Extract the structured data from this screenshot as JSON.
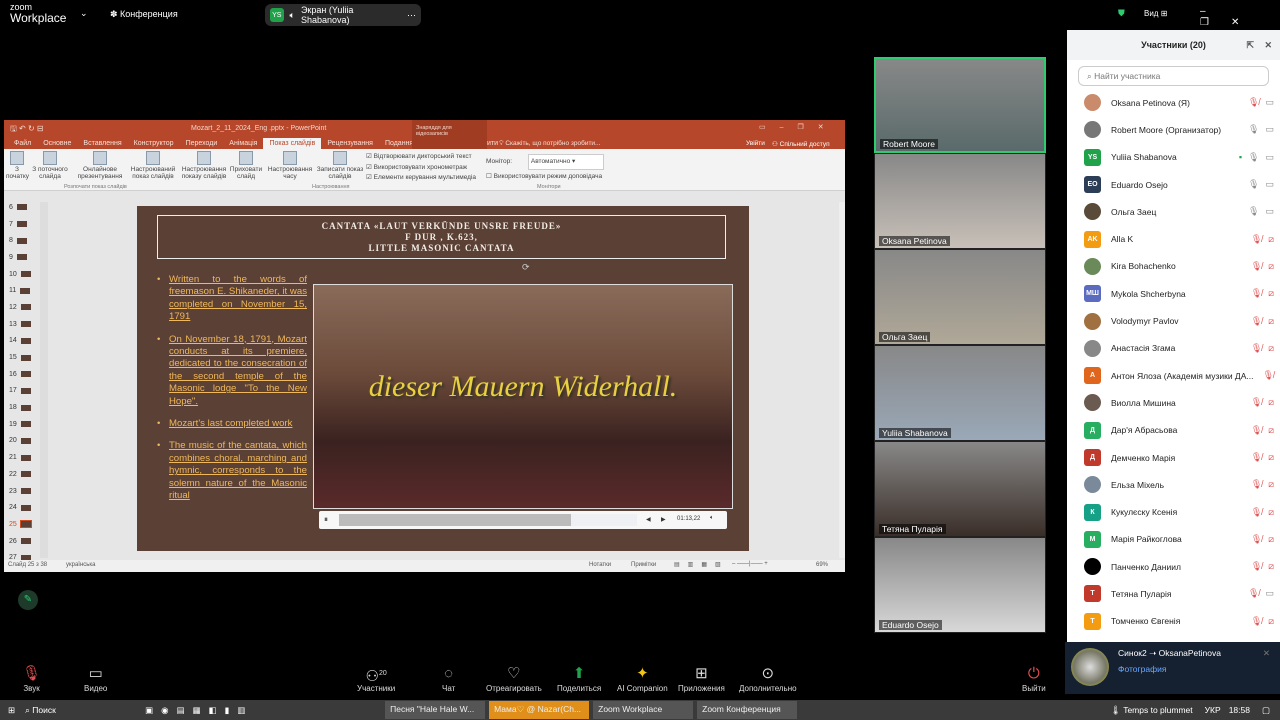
{
  "topbar": {
    "logo_small": "zoom",
    "logo_big": "Workplace",
    "meeting": "Конференция",
    "share_initials": "YS",
    "share_label": "Экран (Yuliia Shabanova)",
    "view_label": "Вид"
  },
  "ppt": {
    "file_title": "Mozart_2_11_2024_Eng .pptx - PowerPoint",
    "context_tab": "Знаряддя для відеозаписів",
    "signin": "Увійти",
    "share": "Спільний доступ",
    "tabs": [
      "Файл",
      "Основне",
      "Вставлення",
      "Конструктор",
      "Переходи",
      "Анімація",
      "Показ слайдів",
      "Рецензування",
      "Подання",
      "Формат",
      "Відтворити"
    ],
    "tell_me": "Скажіть, що потрібно зробити...",
    "ribbon": {
      "from_start": "З початку",
      "from_current": "З поточного слайда",
      "online": "Онлайнове презентування",
      "custom": "Настроюваний показ слайдів",
      "setup": "Настроювання показу слайдів",
      "hide": "Приховати слайд",
      "rehearse": "Настроювання часу",
      "record": "Записати показ слайдів",
      "chk1": "Відтворювати дикторський текст",
      "chk2": "Використовувати хронометраж",
      "chk3": "Елементи керування мультимедіа",
      "monitor": "Монітор:",
      "monitor_value": "Автоматично",
      "presenter": "Використовувати режим доповідача",
      "grp1": "Розпочати показ слайдів",
      "grp2": "Настроювання",
      "grp3": "Монітори"
    },
    "thumbs": [
      "6",
      "7",
      "8",
      "9",
      "10",
      "11",
      "12",
      "13",
      "14",
      "15",
      "16",
      "17",
      "18",
      "19",
      "20",
      "21",
      "22",
      "23",
      "24",
      "25",
      "26",
      "27"
    ],
    "selected_slide": "25",
    "slide": {
      "title1": "CANTATA «LAUT VERKÜNDE UNSRE FREUDE»",
      "title2": "F DUR , K.623,",
      "title3": "LITTLE MASONIC CANTATA",
      "bullets": [
        "Written to the words of freemason E. Shikaneder, it was completed on November 15, 1791",
        "On November 18, 1791, Mozart conducts at its premiere, dedicated to the consecration of the second temple of the Masonic lodge \"To the New Hope\".",
        "Mozart's last completed work",
        "The music of the cantata, which combines choral, marching and hymnic, corresponds to the solemn nature of the Masonic ritual"
      ],
      "video_caption": "dieser Mauern Widerhall.",
      "media_time": "01:13,22",
      "media_progress": 0.78
    },
    "status": {
      "slide_count": "Слайд 25 з 38",
      "language": "українська",
      "notes": "Нотатки",
      "comments": "Примітки",
      "zoom": "69%"
    }
  },
  "tiles": [
    {
      "name": "Robert Moore",
      "speaking": true
    },
    {
      "name": "Oksana Petinova"
    },
    {
      "name": "Ольга Заец"
    },
    {
      "name": "Yuliia Shabanova"
    },
    {
      "name": "Тетяна Пуларія"
    },
    {
      "name": "Eduardo Osejo"
    }
  ],
  "panel": {
    "title": "Участники (20)",
    "search_placeholder": "Найти участника",
    "participants": [
      {
        "name": "Oksana Petinova (Я)",
        "av": "",
        "color": "#c98b6b",
        "mic": "muted",
        "cam": "on"
      },
      {
        "name": "Robert Moore (Организатор)",
        "av": "",
        "color": "#777",
        "mic": "on",
        "cam": "on"
      },
      {
        "name": "Yuliia Shabanova",
        "av": "YS",
        "color": "#1fa24a",
        "mic": "on",
        "cam": "on",
        "sharing": true
      },
      {
        "name": "Eduardo Osejo",
        "av": "EO",
        "color": "#2c3e55",
        "mic": "on",
        "cam": "on"
      },
      {
        "name": "Ольга Заец",
        "av": "",
        "color": "#5a4a3a",
        "mic": "on",
        "cam": "on"
      },
      {
        "name": "Alla K",
        "av": "AK",
        "color": "#f39c12",
        "mic": "muted",
        "cam": "off"
      },
      {
        "name": "Kira Bohachenko",
        "av": "",
        "color": "#6a8a5a",
        "mic": "muted",
        "cam": "off"
      },
      {
        "name": "Mykola Shcherbyna",
        "av": "МШ",
        "color": "#5b6bc0",
        "mic": "muted",
        "cam": "off"
      },
      {
        "name": "Volodymyr Pavlov",
        "av": "",
        "color": "#a07040",
        "mic": "muted",
        "cam": "off"
      },
      {
        "name": "Анастасія Згама",
        "av": "",
        "color": "#888",
        "mic": "muted",
        "cam": "off"
      },
      {
        "name": "Антон Ялоза (Академія музики ДА...",
        "av": "А",
        "color": "#e0661e",
        "mic": "muted",
        "cam": "none"
      },
      {
        "name": "Виолла Мишина",
        "av": "",
        "color": "#6a5a50",
        "mic": "muted",
        "cam": "off"
      },
      {
        "name": "Дар'я Абрасьова",
        "av": "Д",
        "color": "#27ae60",
        "mic": "muted",
        "cam": "off"
      },
      {
        "name": "Демченко Марія",
        "av": "Д",
        "color": "#c0392b",
        "mic": "muted",
        "cam": "off"
      },
      {
        "name": "Ельза Міхель",
        "av": "",
        "color": "#7a8a9a",
        "mic": "muted",
        "cam": "off"
      },
      {
        "name": "Кукулєску Ксенія",
        "av": "К",
        "color": "#16a085",
        "mic": "muted",
        "cam": "off"
      },
      {
        "name": "Марія Райкоглова",
        "av": "М",
        "color": "#27ae60",
        "mic": "muted",
        "cam": "off"
      },
      {
        "name": "Панченко Даниил",
        "av": "",
        "color": "#000",
        "mic": "muted",
        "cam": "off"
      },
      {
        "name": "Тетяна Пуларія",
        "av": "Т",
        "color": "#c0392b",
        "mic": "muted",
        "cam": "on"
      },
      {
        "name": "Томченко Євгенія",
        "av": "Т",
        "color": "#f39c12",
        "mic": "muted",
        "cam": "off"
      }
    ]
  },
  "notification": {
    "title": "Синок2 ➝ OksanaPetinova",
    "body": "Фотография"
  },
  "toolbar": {
    "audio": "Звук",
    "video": "Видео",
    "participants": "Участники",
    "participants_count": "20",
    "chat": "Чат",
    "react": "Отреагировать",
    "share": "Поделиться",
    "ai": "AI Companion",
    "apps": "Приложения",
    "more": "Дополнительно",
    "leave": "Выйти"
  },
  "taskbar": {
    "search": "Поиск",
    "tasks": [
      "Песня \"Hale Hale W...",
      "Мама♡ @ Nazar(Ch...",
      "Zoom Workplace",
      "Zoom Конференция"
    ],
    "weather": "Temps to plummet",
    "lang": "УКР",
    "time": "18:58"
  },
  "colors": {
    "ppt_accent": "#b7472a",
    "zoom_green": "#1fa24a",
    "muted_red": "#e05050",
    "slide_bg": "#5b4036"
  }
}
